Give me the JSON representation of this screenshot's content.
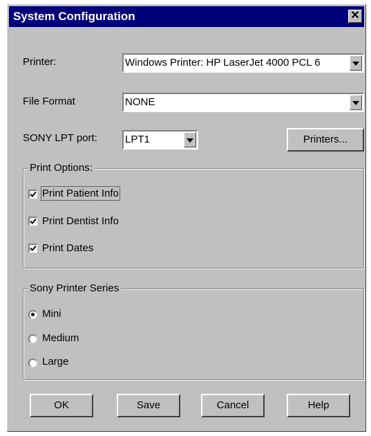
{
  "window": {
    "title": "System Configuration",
    "close_label": "✕"
  },
  "printer": {
    "label": "Printer:",
    "value": "Windows Printer: HP LaserJet 4000 PCL 6"
  },
  "file_format": {
    "label": "File Format",
    "value": "NONE"
  },
  "sony_lpt": {
    "label": "SONY LPT port:",
    "value": "LPT1"
  },
  "printers_button": "Printers...",
  "print_options": {
    "title": "Print Options:",
    "items": [
      {
        "label": "Print Patient Info",
        "checked": true
      },
      {
        "label": "Print Dentist Info",
        "checked": true
      },
      {
        "label": "Print Dates",
        "checked": true
      }
    ]
  },
  "sony_series": {
    "title": "Sony Printer Series",
    "options": [
      {
        "label": "Mini",
        "selected": true
      },
      {
        "label": "Medium",
        "selected": false
      },
      {
        "label": "Large",
        "selected": false
      }
    ]
  },
  "buttons": {
    "ok": "OK",
    "save": "Save",
    "cancel": "Cancel",
    "help": "Help"
  }
}
